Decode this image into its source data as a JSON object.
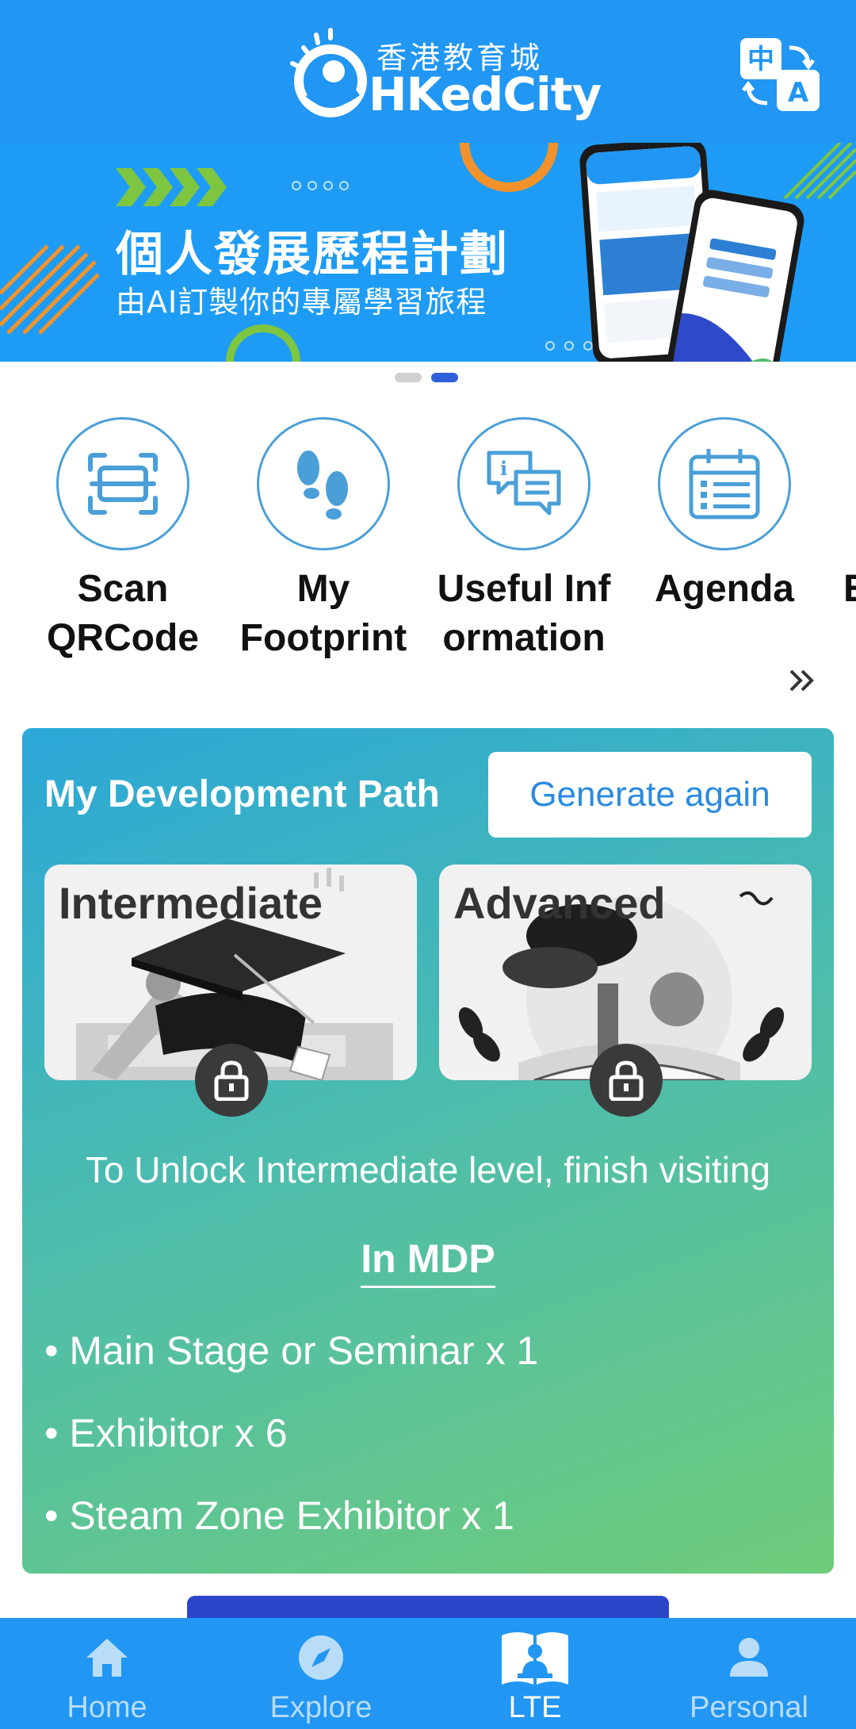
{
  "header": {
    "logo_zh": "香港教育城",
    "logo_en": "HKedCity",
    "lang_toggle": {
      "zh": "中",
      "en": "A"
    }
  },
  "banner": {
    "title": "個人發展歷程計劃",
    "subtitle": "由AI訂製你的專屬學習旅程",
    "pages": 2,
    "active_page": 2
  },
  "quick_actions": [
    {
      "label": "Scan QRCode",
      "icon": "scan-qr-icon"
    },
    {
      "label": "My Footprint",
      "icon": "footprint-icon"
    },
    {
      "label": "Useful Information",
      "icon": "info-chat-icon"
    },
    {
      "label": "Agenda",
      "icon": "calendar-icon"
    },
    {
      "label": "E",
      "icon": "partial-icon"
    }
  ],
  "quick_action_labels": {
    "scan": [
      "Scan",
      "QRCode"
    ],
    "footprint": [
      "My",
      "Footprint"
    ],
    "info": [
      "Useful Inf",
      "ormation"
    ],
    "agenda": [
      "Agenda"
    ],
    "partial": [
      "E"
    ]
  },
  "dev_path": {
    "title": "My Development Path",
    "generate_label": "Generate again",
    "levels": [
      {
        "name": "Intermediate",
        "locked": true
      },
      {
        "name": "Advanced",
        "locked": true
      }
    ],
    "unlock_text": "To Unlock Intermediate level, finish visiting",
    "venue": "In MDP",
    "requirements": [
      "• Main Stage or Seminar x 1",
      "• Exhibitor x 6",
      "• Steam Zone Exhibitor x 1"
    ]
  },
  "bottom_nav": [
    {
      "label": "Home",
      "icon": "home-icon",
      "active": false
    },
    {
      "label": "Explore",
      "icon": "compass-icon",
      "active": false
    },
    {
      "label": "LTE",
      "icon": "book-reader-icon",
      "active": true
    },
    {
      "label": "Personal",
      "icon": "person-icon",
      "active": false
    }
  ],
  "colors": {
    "primary": "#2196f3",
    "accent_blue": "#2f5fd8",
    "card_gradient_start": "#2ba7d8",
    "card_gradient_end": "#6fcc7a"
  }
}
